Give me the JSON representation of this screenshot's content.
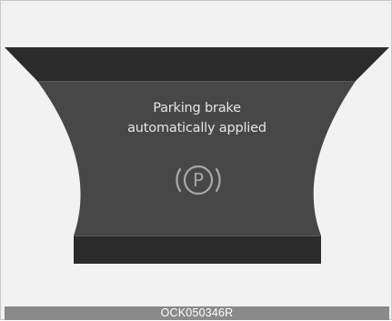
{
  "cluster": {
    "message_line1": "Parking brake",
    "message_line2": "automatically applied",
    "indicator_icon": "parking-brake-icon",
    "indicator_letter": "P"
  },
  "footer": {
    "code": "OCK050346R"
  },
  "colors": {
    "background": "#f2f2f2",
    "bar": "#2b2b2b",
    "panel": "#474747",
    "text": "#e6e6e6",
    "footer_bg": "#8a8a8a"
  }
}
